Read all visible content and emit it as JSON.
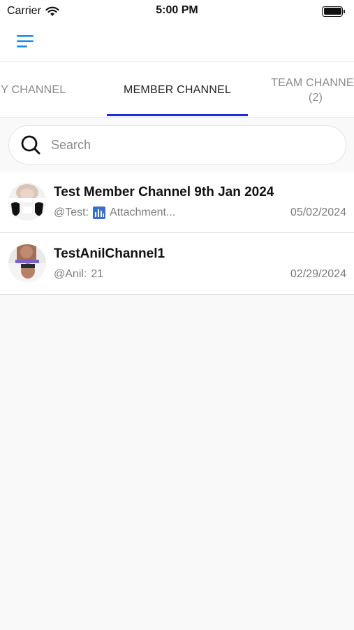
{
  "status_bar": {
    "carrier": "Carrier",
    "time": "5:00 PM"
  },
  "header": {
    "menu_icon": "hamburger-menu-icon",
    "accent_color": "#1e8ae6"
  },
  "tabs": [
    {
      "label": "MY CHANNEL",
      "sub": ""
    },
    {
      "label": "MEMBER CHANNEL",
      "sub": "",
      "active": true
    },
    {
      "label": "TEAM CHANNEL",
      "sub": "(2)"
    }
  ],
  "tab_indicator_color": "#1d2bd6",
  "search": {
    "placeholder": "Search",
    "value": ""
  },
  "channels": [
    {
      "title": "Test Member Channel 9th Jan 2024",
      "sender": "@Test:",
      "message": "Attachment...",
      "has_attachment_icon": true,
      "date": "05/02/2024"
    },
    {
      "title": "TestAnilChannel1",
      "sender": "@Anil:",
      "message": "21",
      "has_attachment_icon": false,
      "date": "02/29/2024"
    }
  ]
}
